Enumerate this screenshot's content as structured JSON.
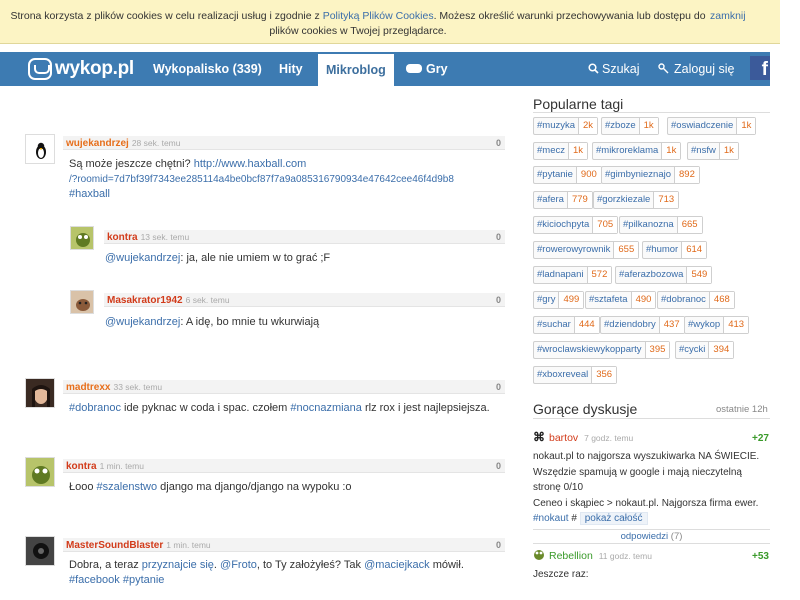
{
  "cookie": {
    "text_before": "Strona korzysta z plików cookies w celu realizacji usług i zgodnie z ",
    "link": "Polityką Plików Cookies",
    "text_after": ". Możesz określić warunki przechowywania lub dostępu do plików cookies w Twojej przeglądarce.",
    "close": "zamknij"
  },
  "nav": {
    "logo": "wykop.pl",
    "items": [
      "Wykopalisko (339)",
      "Hity",
      "Mikroblog",
      "Gry"
    ],
    "search": "Szukaj",
    "login": "Zaloguj się",
    "fb": "f"
  },
  "feed": [
    {
      "author": "wujekandrzej",
      "time": "28 sek. temu",
      "votes": "0",
      "line1": "Są może jeszcze chętni? ",
      "link1": "http://www.haxball.com",
      "link2": "/?roomid=7d7bf39f7343ee285114a4be0bcf87f7a9a085316790934e47642cee46f4d9b8",
      "tag": "#haxball",
      "replies": [
        {
          "author": "kontra",
          "time": "13 sek. temu",
          "votes": "0",
          "mention": "@wujekandrzej",
          "text": ": ja, ale nie umiem w to grać ;F"
        },
        {
          "author": "Masakrator1942",
          "time": "6 sek. temu",
          "votes": "0",
          "mention": "@wujekandrzej",
          "text": ": A idę, bo mnie tu wkurwiają"
        }
      ]
    },
    {
      "author": "madtrexx",
      "time": "33 sek. temu",
      "votes": "0",
      "t1": "#dobranoc",
      "t2": " ide pyknac w coda i spac. czołem ",
      "t3": "#nocnazmiana",
      "t4": " rlz rox i jest najlepsiejsza."
    },
    {
      "author": "kontra",
      "time": "1 min. temu",
      "votes": "0",
      "t1": "Łooo ",
      "t2": "#szalenstwo",
      "t3": " django ma django/django na wypoku :o"
    },
    {
      "author": "MasterSoundBlaster",
      "time": "1 min. temu",
      "votes": "0",
      "t1": "Dobra, a teraz ",
      "t2": "przyznajcie się",
      "t3": ". ",
      "t4": "@Froto",
      "t5": ", to Ty założyłeś? Tak ",
      "t6": "@maciejkack",
      "t7": " mówił.",
      "tag1": "#facebook",
      "tag2": "#pytanie"
    }
  ],
  "sidebar": {
    "tags_title": "Popularne tagi",
    "tags": [
      [
        "#muzyka",
        "2k"
      ],
      [
        "#zboze",
        "1k"
      ],
      [
        "#oswiadczenie",
        "1k"
      ],
      [
        "#mecz",
        "1k"
      ],
      [
        "#mikroreklama",
        "1k"
      ],
      [
        "#nsfw",
        "1k"
      ],
      [
        "#pytanie",
        "900"
      ],
      [
        "#gimbynieznajo",
        "892"
      ],
      [
        "#afera",
        "779"
      ],
      [
        "#gorzkiezale",
        "713"
      ],
      [
        "#kiciochpyta",
        "705"
      ],
      [
        "#pilkanozna",
        "665"
      ],
      [
        "#rowerowyrownik",
        "655"
      ],
      [
        "#humor",
        "614"
      ],
      [
        "#ladnapani",
        "572"
      ],
      [
        "#aferazbozowa",
        "549"
      ],
      [
        "#gry",
        "499"
      ],
      [
        "#sztafeta",
        "490"
      ],
      [
        "#dobranoc",
        "468"
      ],
      [
        "#suchar",
        "444"
      ],
      [
        "#dziendobry",
        "437"
      ],
      [
        "#wykop",
        "413"
      ],
      [
        "#wroclawskiewykopparty",
        "395"
      ],
      [
        "#cycki",
        "394"
      ],
      [
        "#xboxreveal",
        "356"
      ]
    ],
    "hot_title": "Gorące dyskusje",
    "hot_period": "ostatnie 12h",
    "hot1": {
      "user": "bartov",
      "time": "7 godz. temu",
      "score": "+27",
      "lines": [
        "nokaut.pl to najgorsza wyszukiwarka NA ŚWIECIE.",
        "Wszędzie spamują w google i mają nieczytelną",
        "stronę 0/10",
        "Ceneo i skąpiec > nokaut.pl. Najgorsza firma ewer."
      ],
      "tag": "#nokaut",
      "hash": " #",
      "show_all": "pokaż całość",
      "replies": "odpowiedzi",
      "replies_count": "(7)"
    },
    "hot2": {
      "user": "Rebellion",
      "time": "11 godz. temu",
      "score": "+53",
      "text": "Jeszcze raz:"
    }
  }
}
